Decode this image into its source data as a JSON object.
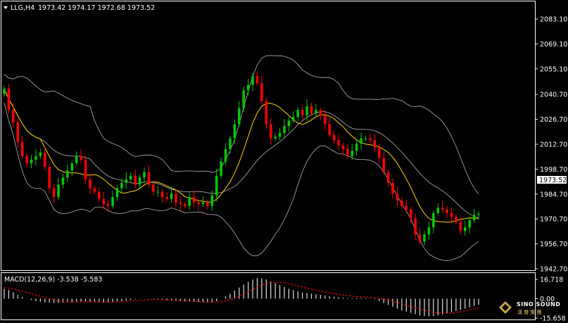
{
  "header": {
    "symbol": "LLG,H4",
    "ohlc": "1973.42 1974.17 1972.68 1973.52",
    "indicator": "MACD(12,26,9) -3.538 -5.583"
  },
  "price_axis": {
    "labels": [
      "2083.10",
      "2069.10",
      "2055.10",
      "2040.70",
      "2026.70",
      "2012.70",
      "1998.70",
      "1984.70",
      "1970.70",
      "1956.70",
      "1942.70"
    ],
    "current_price": "1973.52"
  },
  "macd_axis": {
    "labels": [
      "16.718",
      "0.00",
      "-15.658"
    ]
  },
  "watermark": {
    "brand": "SINO SOUND",
    "sub": "漢 聲 集 團",
    "icon": "diamond-logo-icon"
  },
  "colors": {
    "background": "#000000",
    "bull": "#00c800",
    "bear": "#ff0000",
    "band": "#b4b4b4",
    "ma": "#ffd700",
    "macd_hist": "#e0e0e0",
    "signal": "#ff0000"
  },
  "chart_data": [
    {
      "type": "candlestick",
      "title": "LLG,H4",
      "ylim": [
        1942.7,
        2087
      ],
      "y_ticks": [
        2083.1,
        2069.1,
        2055.1,
        2040.7,
        2026.7,
        2012.7,
        1998.7,
        1984.7,
        1970.7,
        1956.7,
        1942.7
      ],
      "close": [
        2044,
        2032,
        2025,
        2014,
        2006,
        2002,
        2004,
        2006,
        2008,
        2000,
        1988,
        1983,
        1990,
        1994,
        1998,
        2002,
        2006,
        2004,
        1993,
        1988,
        1986,
        1982,
        1979,
        1978,
        1983,
        1988,
        1991,
        1993,
        1995,
        1990,
        1994,
        1997,
        1990,
        1986,
        1986,
        1983,
        1982,
        1985,
        1980,
        1979,
        1978,
        1983,
        1980,
        1979,
        1980,
        1978,
        1984,
        1995,
        2003,
        2010,
        2016,
        2024,
        2033,
        2043,
        2046,
        2051,
        2047,
        2037,
        2024,
        2016,
        2017,
        2019,
        2023,
        2026,
        2028,
        2032,
        2029,
        2034,
        2030,
        2032,
        2029,
        2024,
        2018,
        2015,
        2012,
        2010,
        2006,
        2009,
        2013,
        2016,
        2016,
        2015,
        2011,
        2005,
        1997,
        1991,
        1985,
        1981,
        1978,
        1976,
        1971,
        1962,
        1958,
        1962,
        1966,
        1974,
        1977,
        1976,
        1974,
        1972,
        1969,
        1964,
        1966,
        1970,
        1973,
        1973.52
      ],
      "open_is_prev_close": true,
      "bollinger": {
        "period": 20,
        "stddev": 2
      },
      "moving_average": {
        "period": 9
      }
    },
    {
      "type": "bar",
      "title": "MACD(12,26,9) -3.538 -5.583",
      "ylim": [
        -15.658,
        16.718
      ],
      "series": [
        {
          "name": "MACD",
          "values": [
            8,
            7,
            5,
            3,
            1.5,
            0,
            -1,
            -2,
            -2.5,
            -3,
            -3.2,
            -3.5,
            -3.4,
            -3.2,
            -3,
            -2.8,
            -2.5,
            -2.4,
            -2.2,
            -2.5,
            -2.8,
            -3,
            -3,
            -2.8,
            -2.5,
            -2.2,
            -2,
            -1.5,
            -1,
            -0.5,
            -0.2,
            0,
            -0.2,
            -0.5,
            -0.8,
            -1,
            -1.2,
            -1.5,
            -1.8,
            -2,
            -2.2,
            -2.4,
            -2.6,
            -2.8,
            -3,
            -3.2,
            -3,
            -2,
            0,
            2,
            4,
            6.5,
            9,
            11.5,
            13.5,
            15.5,
            16.7,
            16.4,
            15.5,
            14,
            12.5,
            11,
            9.5,
            8,
            7,
            6,
            5,
            4.5,
            4,
            3.5,
            3,
            2.5,
            2,
            1.6,
            1.2,
            0.8,
            0.5,
            0.5,
            0.6,
            0.5,
            0.4,
            0.2,
            -0.5,
            -2,
            -3.5,
            -5,
            -6.5,
            -8,
            -9.5,
            -10.5,
            -11.5,
            -12.5,
            -13.5,
            -14,
            -14.3,
            -14,
            -13.5,
            -12.8,
            -12,
            -11,
            -10,
            -9,
            -8,
            -7,
            -6,
            -5
          ]
        },
        {
          "name": "Signal",
          "values": [
            9,
            8.5,
            8,
            7,
            6,
            5,
            4,
            3,
            2,
            1,
            0,
            -1,
            -1.6,
            -2,
            -2.4,
            -2.6,
            -2.7,
            -2.6,
            -2.5,
            -2.5,
            -2.5,
            -2.6,
            -2.7,
            -2.8,
            -2.8,
            -2.7,
            -2.5,
            -2.3,
            -2,
            -1.7,
            -1.3,
            -1,
            -0.8,
            -0.7,
            -0.7,
            -0.8,
            -0.9,
            -1.1,
            -1.3,
            -1.5,
            -1.7,
            -1.9,
            -2.1,
            -2.3,
            -2.5,
            -2.7,
            -2.8,
            -2.8,
            -2.5,
            -1.8,
            -0.8,
            0.5,
            2,
            3.8,
            5.7,
            7.6,
            9.5,
            11,
            12.2,
            12.9,
            13.2,
            13.1,
            12.7,
            12.1,
            11.3,
            10.4,
            9.5,
            8.6,
            7.7,
            6.9,
            6.1,
            5.4,
            4.7,
            4.1,
            3.5,
            2.9,
            2.4,
            2,
            1.7,
            1.5,
            1.3,
            1.1,
            0.8,
            0.3,
            -0.3,
            -1.1,
            -2,
            -3,
            -4.1,
            -5.2,
            -6.3,
            -7.4,
            -8.4,
            -9.4,
            -10.3,
            -11,
            -11.5,
            -11.8,
            -11.8,
            -11.6,
            -11.2,
            -10.6,
            -9.9,
            -9.1,
            -8.2,
            -7.3
          ]
        }
      ]
    }
  ]
}
